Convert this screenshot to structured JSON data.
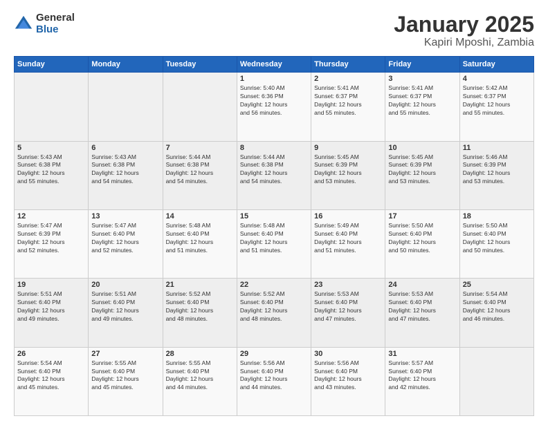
{
  "header": {
    "logo_general": "General",
    "logo_blue": "Blue",
    "month_title": "January 2025",
    "location": "Kapiri Mposhi, Zambia"
  },
  "days_of_week": [
    "Sunday",
    "Monday",
    "Tuesday",
    "Wednesday",
    "Thursday",
    "Friday",
    "Saturday"
  ],
  "weeks": [
    [
      {
        "day": "",
        "info": ""
      },
      {
        "day": "",
        "info": ""
      },
      {
        "day": "",
        "info": ""
      },
      {
        "day": "1",
        "info": "Sunrise: 5:40 AM\nSunset: 6:36 PM\nDaylight: 12 hours\nand 56 minutes."
      },
      {
        "day": "2",
        "info": "Sunrise: 5:41 AM\nSunset: 6:37 PM\nDaylight: 12 hours\nand 55 minutes."
      },
      {
        "day": "3",
        "info": "Sunrise: 5:41 AM\nSunset: 6:37 PM\nDaylight: 12 hours\nand 55 minutes."
      },
      {
        "day": "4",
        "info": "Sunrise: 5:42 AM\nSunset: 6:37 PM\nDaylight: 12 hours\nand 55 minutes."
      }
    ],
    [
      {
        "day": "5",
        "info": "Sunrise: 5:43 AM\nSunset: 6:38 PM\nDaylight: 12 hours\nand 55 minutes."
      },
      {
        "day": "6",
        "info": "Sunrise: 5:43 AM\nSunset: 6:38 PM\nDaylight: 12 hours\nand 54 minutes."
      },
      {
        "day": "7",
        "info": "Sunrise: 5:44 AM\nSunset: 6:38 PM\nDaylight: 12 hours\nand 54 minutes."
      },
      {
        "day": "8",
        "info": "Sunrise: 5:44 AM\nSunset: 6:38 PM\nDaylight: 12 hours\nand 54 minutes."
      },
      {
        "day": "9",
        "info": "Sunrise: 5:45 AM\nSunset: 6:39 PM\nDaylight: 12 hours\nand 53 minutes."
      },
      {
        "day": "10",
        "info": "Sunrise: 5:45 AM\nSunset: 6:39 PM\nDaylight: 12 hours\nand 53 minutes."
      },
      {
        "day": "11",
        "info": "Sunrise: 5:46 AM\nSunset: 6:39 PM\nDaylight: 12 hours\nand 53 minutes."
      }
    ],
    [
      {
        "day": "12",
        "info": "Sunrise: 5:47 AM\nSunset: 6:39 PM\nDaylight: 12 hours\nand 52 minutes."
      },
      {
        "day": "13",
        "info": "Sunrise: 5:47 AM\nSunset: 6:40 PM\nDaylight: 12 hours\nand 52 minutes."
      },
      {
        "day": "14",
        "info": "Sunrise: 5:48 AM\nSunset: 6:40 PM\nDaylight: 12 hours\nand 51 minutes."
      },
      {
        "day": "15",
        "info": "Sunrise: 5:48 AM\nSunset: 6:40 PM\nDaylight: 12 hours\nand 51 minutes."
      },
      {
        "day": "16",
        "info": "Sunrise: 5:49 AM\nSunset: 6:40 PM\nDaylight: 12 hours\nand 51 minutes."
      },
      {
        "day": "17",
        "info": "Sunrise: 5:50 AM\nSunset: 6:40 PM\nDaylight: 12 hours\nand 50 minutes."
      },
      {
        "day": "18",
        "info": "Sunrise: 5:50 AM\nSunset: 6:40 PM\nDaylight: 12 hours\nand 50 minutes."
      }
    ],
    [
      {
        "day": "19",
        "info": "Sunrise: 5:51 AM\nSunset: 6:40 PM\nDaylight: 12 hours\nand 49 minutes."
      },
      {
        "day": "20",
        "info": "Sunrise: 5:51 AM\nSunset: 6:40 PM\nDaylight: 12 hours\nand 49 minutes."
      },
      {
        "day": "21",
        "info": "Sunrise: 5:52 AM\nSunset: 6:40 PM\nDaylight: 12 hours\nand 48 minutes."
      },
      {
        "day": "22",
        "info": "Sunrise: 5:52 AM\nSunset: 6:40 PM\nDaylight: 12 hours\nand 48 minutes."
      },
      {
        "day": "23",
        "info": "Sunrise: 5:53 AM\nSunset: 6:40 PM\nDaylight: 12 hours\nand 47 minutes."
      },
      {
        "day": "24",
        "info": "Sunrise: 5:53 AM\nSunset: 6:40 PM\nDaylight: 12 hours\nand 47 minutes."
      },
      {
        "day": "25",
        "info": "Sunrise: 5:54 AM\nSunset: 6:40 PM\nDaylight: 12 hours\nand 46 minutes."
      }
    ],
    [
      {
        "day": "26",
        "info": "Sunrise: 5:54 AM\nSunset: 6:40 PM\nDaylight: 12 hours\nand 45 minutes."
      },
      {
        "day": "27",
        "info": "Sunrise: 5:55 AM\nSunset: 6:40 PM\nDaylight: 12 hours\nand 45 minutes."
      },
      {
        "day": "28",
        "info": "Sunrise: 5:55 AM\nSunset: 6:40 PM\nDaylight: 12 hours\nand 44 minutes."
      },
      {
        "day": "29",
        "info": "Sunrise: 5:56 AM\nSunset: 6:40 PM\nDaylight: 12 hours\nand 44 minutes."
      },
      {
        "day": "30",
        "info": "Sunrise: 5:56 AM\nSunset: 6:40 PM\nDaylight: 12 hours\nand 43 minutes."
      },
      {
        "day": "31",
        "info": "Sunrise: 5:57 AM\nSunset: 6:40 PM\nDaylight: 12 hours\nand 42 minutes."
      },
      {
        "day": "",
        "info": ""
      }
    ]
  ]
}
